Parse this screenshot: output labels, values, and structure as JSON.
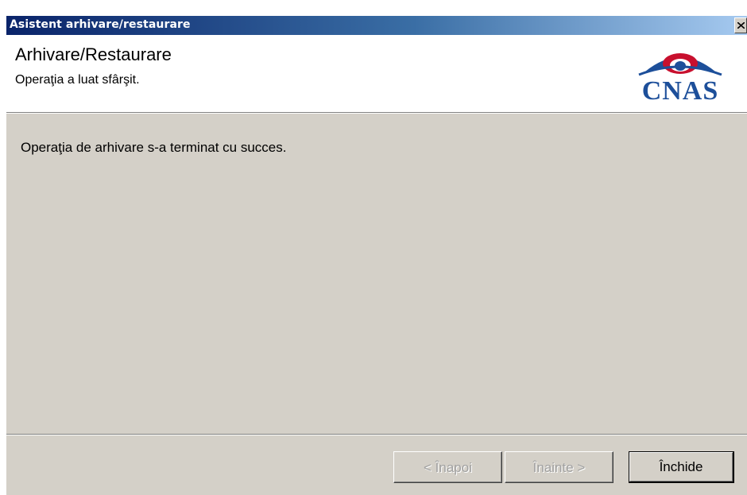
{
  "window": {
    "title": "Asistent arhivare/restaurare"
  },
  "header": {
    "title": "Arhivare/Restaurare",
    "subtitle": "Operaţia a luat sfârşit.",
    "logo_text": "CNAS"
  },
  "content": {
    "message": "Operaţia de arhivare s-a terminat cu succes."
  },
  "buttons": {
    "back_label": "< Înapoi",
    "next_label": "Înainte >",
    "close_label": "Închide"
  },
  "icons": {
    "close": "close-icon",
    "logo": "cnas-logo"
  },
  "colors": {
    "titlebar_start": "#0a246a",
    "titlebar_end": "#a6caf0",
    "dialog_face": "#d4d0c8",
    "logo_blue": "#1d4f9a",
    "logo_red": "#c8102e"
  }
}
